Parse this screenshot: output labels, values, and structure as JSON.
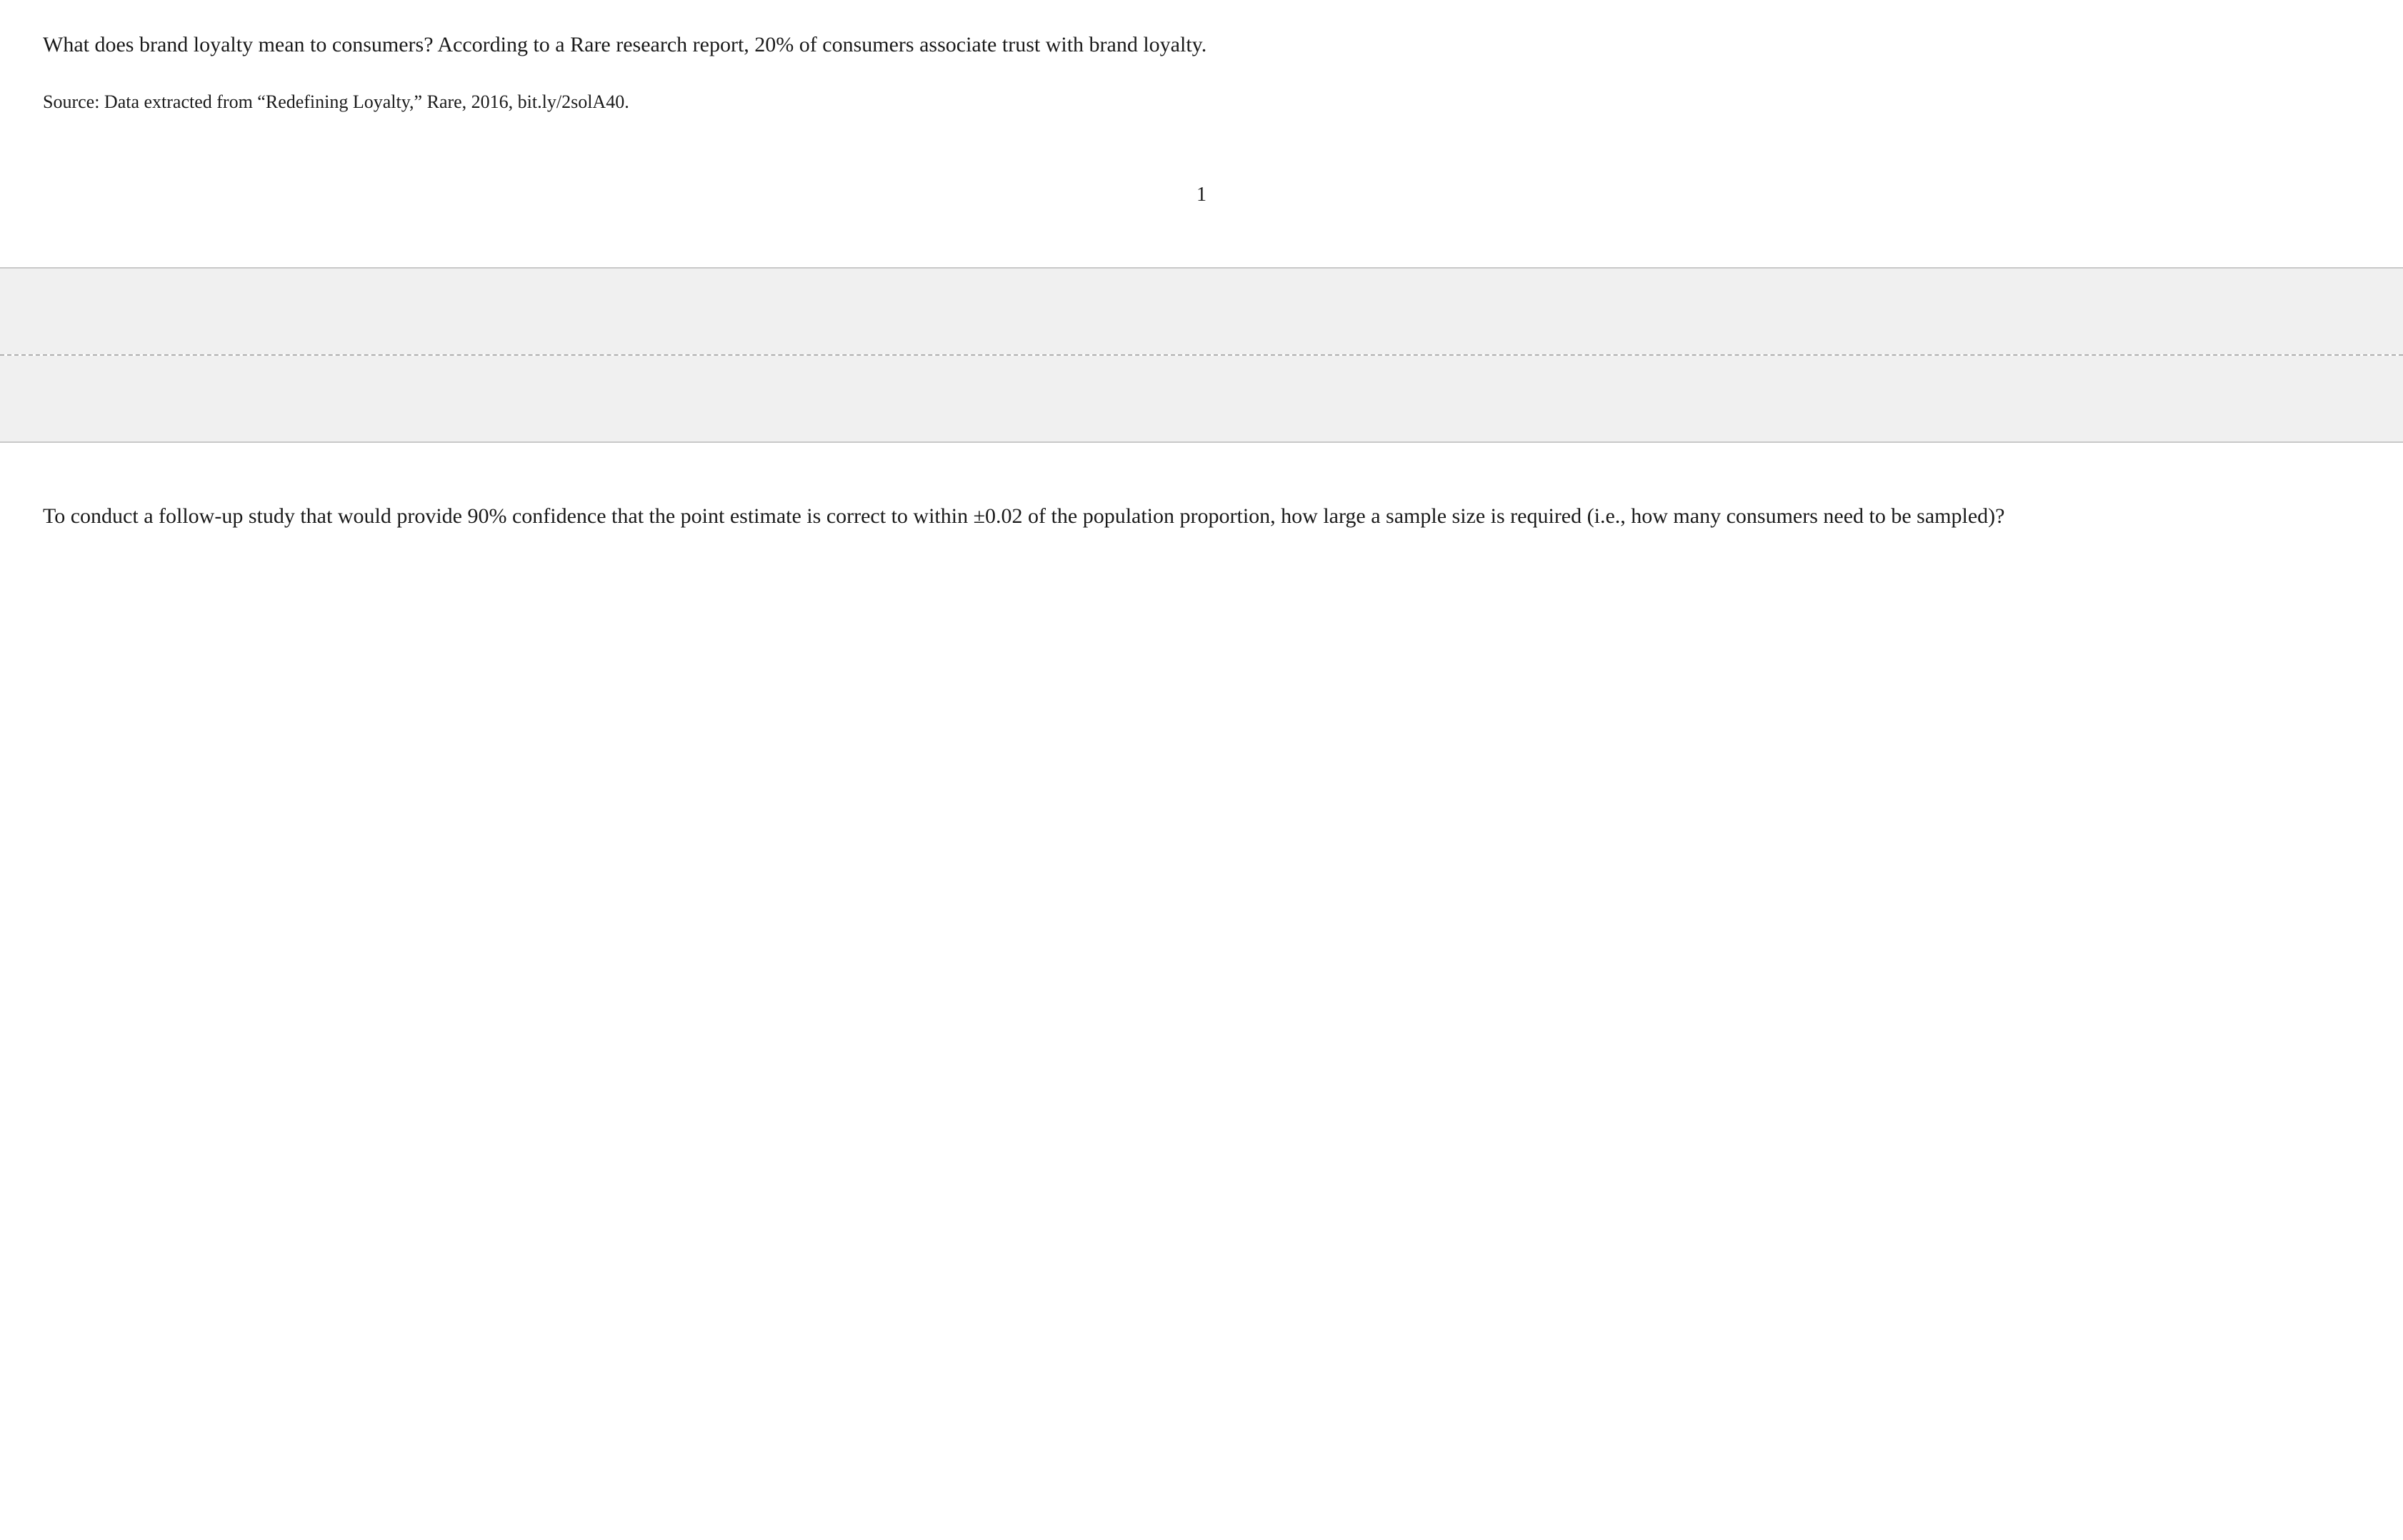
{
  "top": {
    "intro_paragraph": "What does brand loyalty mean to consumers? According to a Rare research report, 20% of consumers associate trust with brand loyalty.",
    "source_line": "Source: Data extracted from “Redefining Loyalty,” Rare, 2016, bit.ly/2solA40."
  },
  "page_number": {
    "label": "1"
  },
  "bottom": {
    "follow_up_paragraph": "To conduct a follow-up study that would provide 90% confidence that the point estimate is correct to within ±0.02 of the population proportion, how large a sample size is required (i.e., how many consumers need to be sampled)?"
  }
}
